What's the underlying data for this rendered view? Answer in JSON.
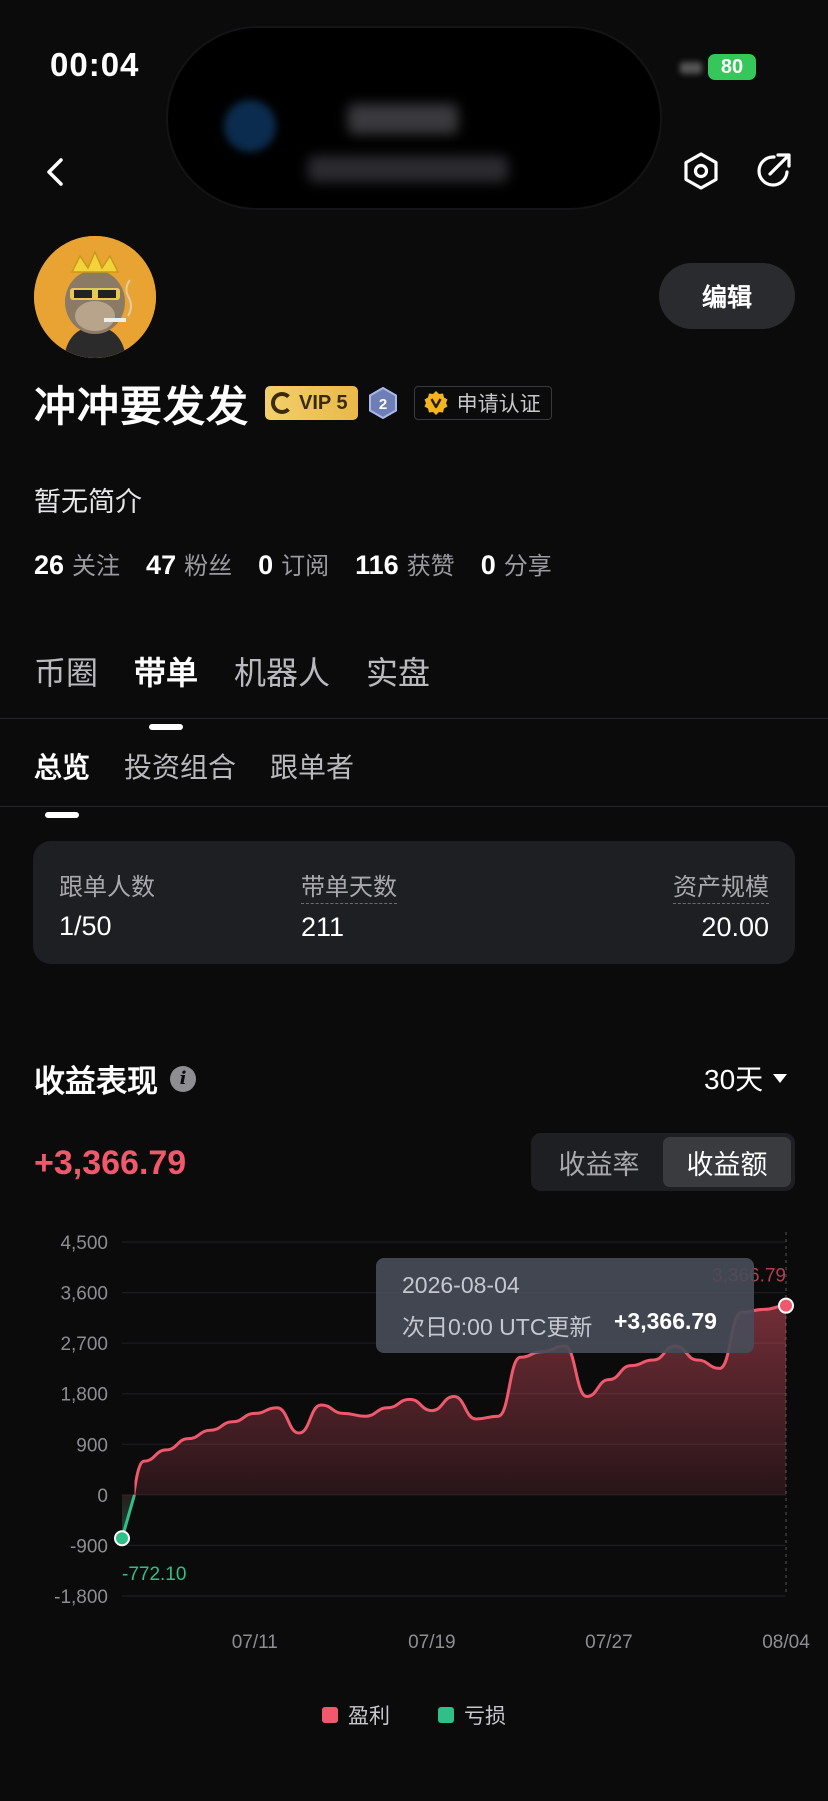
{
  "status_bar": {
    "time": "00:04",
    "battery": "80"
  },
  "colors": {
    "profit": "#f0586c",
    "loss": "#2fbf88",
    "background": "#0b0b0c",
    "card": "#1e1f22",
    "vip_gold": "#e9b948"
  },
  "nav": {
    "back_icon": "chevron-left-icon",
    "settings_icon": "hexagon-settings-icon",
    "share_icon": "share-arrow-icon"
  },
  "profile": {
    "avatar_icon": "ape-avatar",
    "edit_label": "编辑",
    "name": "冲冲要发发",
    "vip_label": "VIP 5",
    "level": "2",
    "verify_label": "申请认证",
    "bio": "暂无简介",
    "stats": [
      {
        "num": "26",
        "label": "关注"
      },
      {
        "num": "47",
        "label": "粉丝"
      },
      {
        "num": "0",
        "label": "订阅"
      },
      {
        "num": "116",
        "label": "获赞"
      },
      {
        "num": "0",
        "label": "分享"
      }
    ]
  },
  "main_tabs": [
    {
      "label": "币圈",
      "active": false
    },
    {
      "label": "带单",
      "active": true
    },
    {
      "label": "机器人",
      "active": false
    },
    {
      "label": "实盘",
      "active": false
    }
  ],
  "sub_tabs": [
    {
      "label": "总览",
      "active": true
    },
    {
      "label": "投资组合",
      "active": false
    },
    {
      "label": "跟单者",
      "active": false
    }
  ],
  "summary": {
    "followers": {
      "label": "跟单人数",
      "value": "1/50"
    },
    "days": {
      "label": "带单天数",
      "value": "211"
    },
    "aum": {
      "label": "资产规模",
      "value": "20.00"
    }
  },
  "performance": {
    "title": "收益表现",
    "period": "30天",
    "total": "+3,366.79",
    "toggle": [
      "收益率",
      "收益额"
    ],
    "toggle_active": 1
  },
  "tooltip": {
    "date": "2026-08-04",
    "label": "次日0:00 UTC更新",
    "value": "+3,366.79"
  },
  "legend": {
    "profit": "盈利",
    "loss": "亏损"
  },
  "chart_data": {
    "type": "area",
    "x_ticks": [
      "07/11",
      "07/19",
      "07/27",
      "08/04"
    ],
    "y_ticks": [
      "4,500",
      "3,600",
      "2,700",
      "1,800",
      "900",
      "0",
      "-900",
      "-1,800"
    ],
    "ylim": [
      -1800,
      4500
    ],
    "grid": true,
    "start_label": "-772.10",
    "end_label": "3,366.79",
    "series": [
      {
        "name": "盈利",
        "x": [
          "07/05",
          "07/06",
          "07/07",
          "07/08",
          "07/09",
          "07/10",
          "07/11",
          "07/12",
          "07/13",
          "07/14",
          "07/15",
          "07/16",
          "07/17",
          "07/18",
          "07/19",
          "07/20",
          "07/21",
          "07/22",
          "07/23",
          "07/24",
          "07/25",
          "07/26",
          "07/27",
          "07/28",
          "07/29",
          "07/30",
          "07/31",
          "08/01",
          "08/02",
          "08/03",
          "08/04"
        ],
        "values": [
          -772.1,
          600,
          800,
          1000,
          1150,
          1300,
          1450,
          1550,
          1100,
          1600,
          1450,
          1400,
          1550,
          1700,
          1500,
          1750,
          1350,
          1400,
          2450,
          2550,
          2650,
          1750,
          2050,
          2300,
          2400,
          2650,
          2400,
          2250,
          3250,
          3300,
          3366.79
        ]
      }
    ]
  }
}
